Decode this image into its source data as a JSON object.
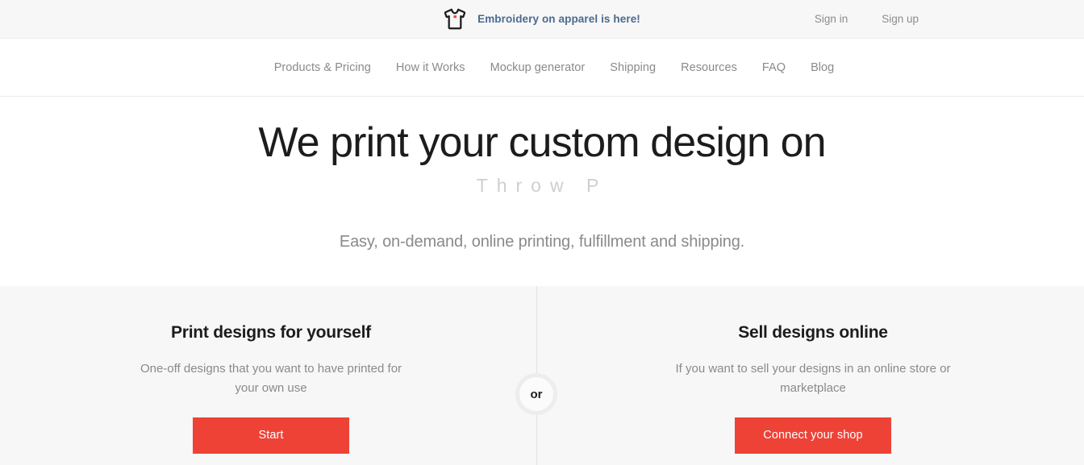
{
  "announcement": {
    "icon": "tshirt-icon",
    "text": "Embroidery on apparel is here!",
    "text_color": "#4b6a8f",
    "background": "#f7f7f7",
    "icon_accent_color": "#ee4237"
  },
  "auth": {
    "sign_in": "Sign in",
    "sign_up": "Sign up"
  },
  "nav": {
    "items": [
      {
        "label": "Products & Pricing"
      },
      {
        "label": "How it Works"
      },
      {
        "label": "Mockup generator"
      },
      {
        "label": "Shipping"
      },
      {
        "label": "Resources"
      },
      {
        "label": "FAQ"
      },
      {
        "label": "Blog"
      }
    ]
  },
  "hero": {
    "title": "We print your custom design on",
    "typed_text": "Throw P",
    "subtitle": "Easy, on-demand, online printing, fulfillment and shipping."
  },
  "choice": {
    "divider_label": "or",
    "left": {
      "title": "Print designs for yourself",
      "description": "One-off designs that you want to have printed for your own use",
      "button_label": "Start"
    },
    "right": {
      "title": "Sell designs online",
      "description": "If you want to sell your designs in an online store or marketplace",
      "button_label": "Connect your shop"
    },
    "button_color": "#ee4237",
    "background": "#f7f7f7"
  }
}
